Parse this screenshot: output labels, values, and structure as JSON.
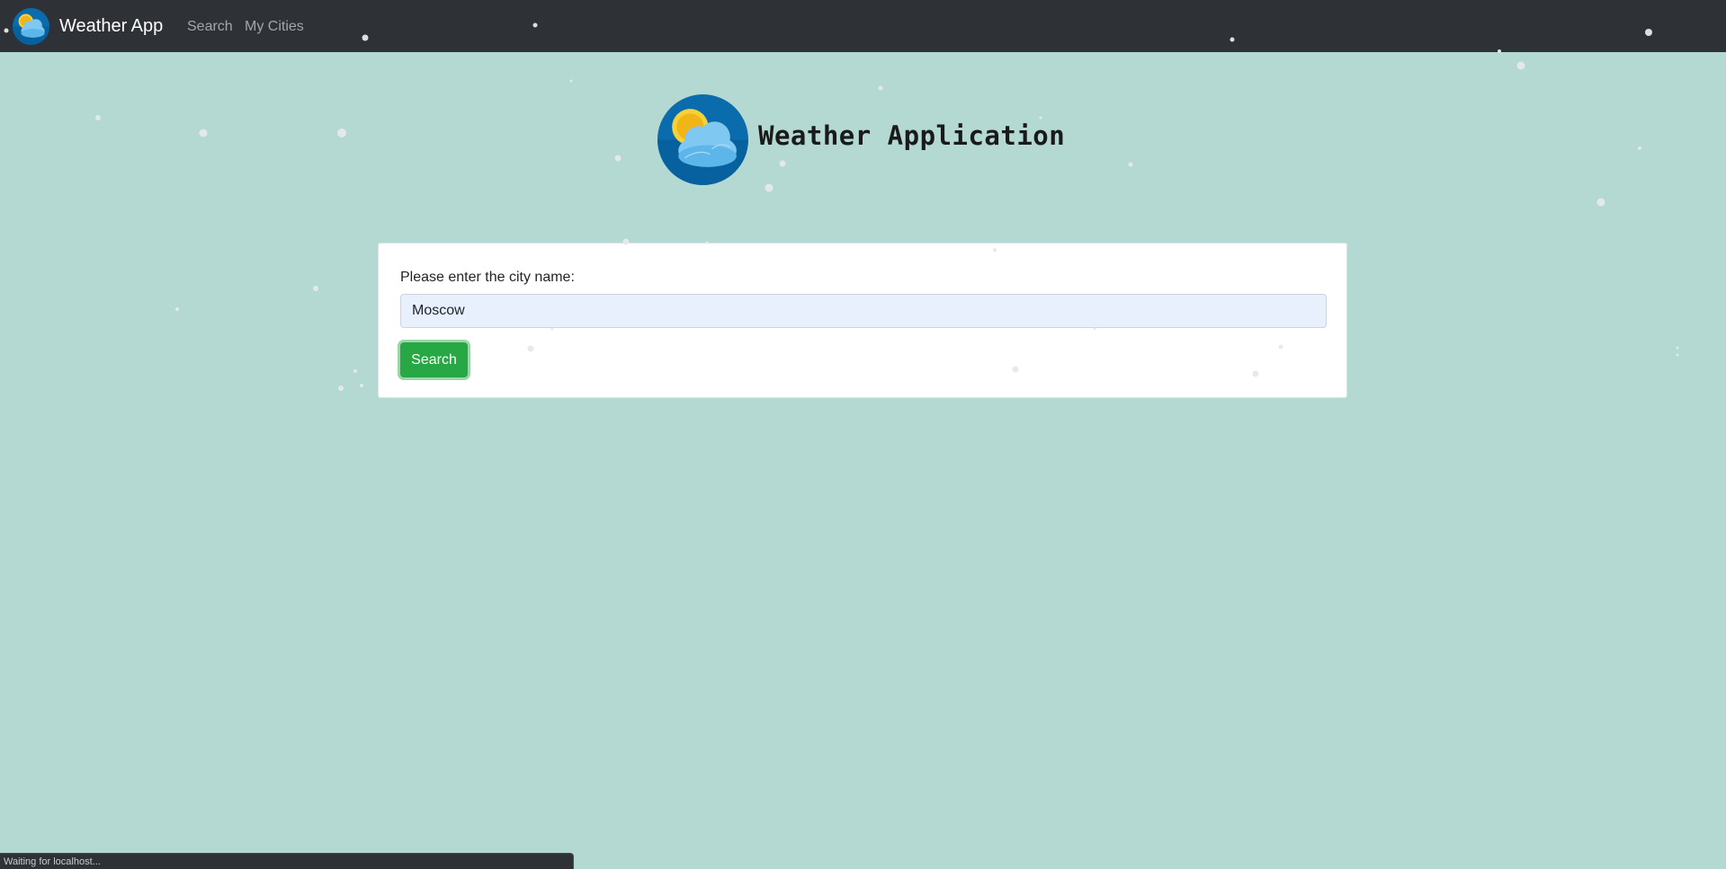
{
  "navbar": {
    "brand": "Weather App",
    "links": [
      "Search",
      "My Cities"
    ]
  },
  "hero": {
    "title": "Weather Application"
  },
  "search_form": {
    "label": "Please enter the city name:",
    "input_value": "Moscow",
    "button_label": "Search"
  },
  "status_bar": {
    "text": "Waiting for localhost..."
  },
  "colors": {
    "page_background": "#b4d9d2",
    "navbar": "#2e3135",
    "accent_button": "#28a745",
    "input_autofill": "#e8f0fe"
  },
  "icons": {
    "logo": "sun-behind-cloud-icon"
  }
}
